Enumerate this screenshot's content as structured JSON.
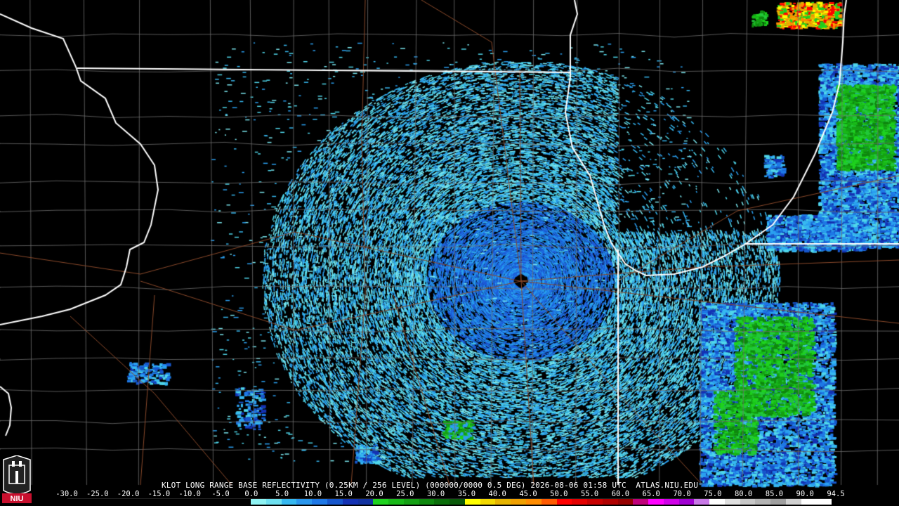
{
  "caption": "KLOT LONG RANGE BASE REFLECTIVITY (0.25KM / 256 LEVEL) (000000/0000 0.5 DEG) 2026-08-06 01:58 UTC  ATLAS.NIU.EDU",
  "logo_text": "NIU",
  "scale": {
    "labels": [
      "-30.0",
      "-25.0",
      "-20.0",
      "-15.0",
      "-10.0",
      "-5.0",
      "0.0",
      "5.0",
      "10.0",
      "15.0",
      "20.0",
      "25.0",
      "30.0",
      "35.0",
      "40.0",
      "45.0",
      "50.0",
      "55.0",
      "60.0",
      "65.0",
      "70.0",
      "75.0",
      "80.0",
      "85.0",
      "90.0",
      "94.5"
    ],
    "colors": [
      "#000000",
      "#000000",
      "#000000",
      "#000000",
      "#000000",
      "#000000",
      "#8ef2f2",
      "#36b8f0",
      "#1e78e6",
      "#1432b4",
      "#1ed21e",
      "#14a014",
      "#0a6e0a",
      "#ffff00",
      "#e6b400",
      "#ff8c00",
      "#ff0000",
      "#c80000",
      "#960000",
      "#ff00ff",
      "#a000d2",
      "#ffffff",
      "#c8c8c8",
      "#a0a0a0",
      "#ffffff",
      "#ffffff"
    ]
  },
  "colors": {
    "state_border": "#ffffff",
    "county_border": "#6e6e6e",
    "highway": "#8b4a2b",
    "background": "#000000",
    "clutter_light": "#3fd0e0",
    "clutter_mid": "#2a9ff0",
    "clutter_dark": "#1e5ad8",
    "precip_green": "#22c83a"
  }
}
